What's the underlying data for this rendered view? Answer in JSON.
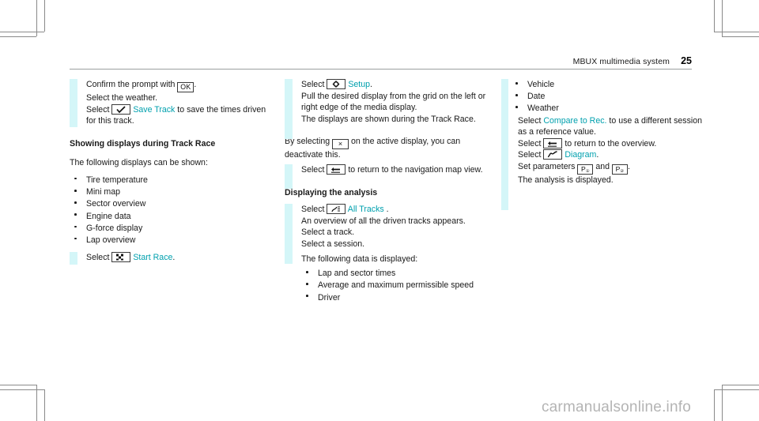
{
  "header": {
    "title": "MBUX multimedia system",
    "page": "25"
  },
  "watermark": "carmanualsonline.info",
  "icons": {
    "ok": "OK",
    "close": "×",
    "checkmark": "checkmark-icon",
    "gear": "gear-icon",
    "back": "back-arrow-icon",
    "flag": "checkered-flag-icon",
    "tracks": "all-tracks-icon",
    "diagram": "diagram-curve-icon",
    "p1": "P",
    "p1sub": "①",
    "p2": "P",
    "p2sub": "②"
  },
  "col1": {
    "steps": [
      {
        "pre": "Confirm the prompt with ",
        "key": "OK",
        "post": "."
      },
      {
        "pre": "Select the weather.",
        "key": "",
        "post": ""
      },
      {
        "pre": "Select ",
        "key": "checkmark",
        "link": "Save Track",
        "post": " to save the times driven for this track."
      }
    ],
    "heading": "Showing displays during Track Race",
    "intro": "The following displays can be shown:",
    "bullets": [
      "Tire temperature",
      "Mini map",
      "Sector overview",
      "Engine data",
      "G-force display",
      "Lap overview"
    ],
    "final": {
      "pre": "Select ",
      "key": "flag",
      "link": "Start Race",
      "post": "."
    }
  },
  "col2": {
    "steps": [
      {
        "pre": "Select ",
        "key": "gear",
        "link": "Setup",
        "post": "."
      },
      {
        "pre": "Pull the desired display from the grid on the left or right edge of the media display.",
        "key": "",
        "post": ""
      }
    ],
    "step2_extra": "The displays are shown during the Track Race.",
    "deactivate_pre": "By selecting ",
    "deactivate_key": "×",
    "deactivate_post": " on the active display, you can deactivate this.",
    "nav_step": {
      "pre": "Select ",
      "key": "back",
      "post": " to return to the navigation map view."
    },
    "heading": "Displaying the analysis",
    "analysis_steps": [
      {
        "pre": "Select ",
        "key": "tracks",
        "link": "All Tracks",
        "post": " ."
      },
      {
        "pre": "Select a track.",
        "key": "",
        "post": ""
      },
      {
        "pre": "Select a session.",
        "key": "",
        "post": ""
      }
    ],
    "analysis_note": "An overview of all the driven tracks appears.",
    "data_intro": "The following data is displayed:",
    "data_bullets": [
      "Lap and sector times",
      "Average and maximum permissible speed",
      "Driver"
    ]
  },
  "col3": {
    "bullets": [
      "Vehicle",
      "Date",
      "Weather"
    ],
    "steps": [
      {
        "pre": "Select ",
        "link": "Compare to Rec.",
        "post": " to use a different session as a reference value."
      },
      {
        "pre": "Select ",
        "key": "back",
        "post": " to return to the overview."
      },
      {
        "pre": "Select ",
        "key": "diagram",
        "link": "Diagram",
        "post": "."
      },
      {
        "pre": "Set parameters ",
        "key": "p1",
        "mid": " and ",
        "key2": "p2",
        "post": "."
      }
    ],
    "final_note": "The analysis is displayed."
  },
  "colors": {
    "accent": "#00a0ae",
    "band": "#d4f6f8",
    "rule": "#9aa0a0"
  }
}
